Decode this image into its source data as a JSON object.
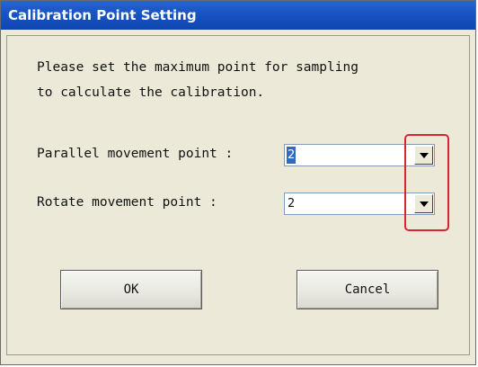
{
  "dialog": {
    "title": "Calibration Point Setting",
    "message_line1": "Please set the maximum point for sampling",
    "message_line2": "to calculate the calibration.",
    "parallel": {
      "label": "Parallel movement point :",
      "value": "2"
    },
    "rotate": {
      "label": "Rotate movement point :",
      "value": "2"
    },
    "ok_label": "OK",
    "cancel_label": "Cancel"
  },
  "colors": {
    "titlebar": "#1955c4",
    "dialog_bg": "#ece9d8",
    "selection": "#316ac5",
    "highlight_box": "#d8262e"
  },
  "icons": {
    "dropdown": "chevron-down-icon"
  }
}
